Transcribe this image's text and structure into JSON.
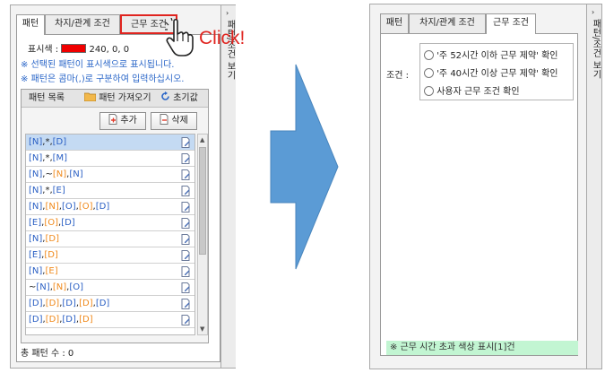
{
  "left_panel": {
    "tabs": [
      "패턴",
      "차지/관계 조건",
      "근무 조건"
    ],
    "color_label": "표시색 :",
    "color_value": "240, 0, 0",
    "notes": [
      "※ 선택된 패턴이 표시색으로 표시됩니다.",
      "※ 패턴은 콤마(,)로 구분하여 입력하십시오."
    ],
    "list_tab": "패턴 목록",
    "import_label": "패턴 가져오기",
    "reset_label": "초기값",
    "add_label": "추가",
    "delete_label": "삭제",
    "patterns": [
      [
        {
          "t": "[N]",
          "c": "b"
        },
        {
          "t": ",*,",
          "c": "k"
        },
        {
          "t": "[D]",
          "c": "b"
        }
      ],
      [
        {
          "t": "[N]",
          "c": "b"
        },
        {
          "t": ",*,",
          "c": "k"
        },
        {
          "t": "[M]",
          "c": "b"
        }
      ],
      [
        {
          "t": "[N]",
          "c": "b"
        },
        {
          "t": ",~",
          "c": "k"
        },
        {
          "t": "[N]",
          "c": "o"
        },
        {
          "t": ",",
          "c": "k"
        },
        {
          "t": "[N]",
          "c": "b"
        }
      ],
      [
        {
          "t": "[N]",
          "c": "b"
        },
        {
          "t": ",*,",
          "c": "k"
        },
        {
          "t": "[E]",
          "c": "b"
        }
      ],
      [
        {
          "t": "[N]",
          "c": "b"
        },
        {
          "t": ",",
          "c": "k"
        },
        {
          "t": "[N]",
          "c": "o"
        },
        {
          "t": ",",
          "c": "k"
        },
        {
          "t": "[O]",
          "c": "b"
        },
        {
          "t": ",",
          "c": "k"
        },
        {
          "t": "[O]",
          "c": "o"
        },
        {
          "t": ",",
          "c": "k"
        },
        {
          "t": "[D]",
          "c": "b"
        }
      ],
      [
        {
          "t": "[E]",
          "c": "b"
        },
        {
          "t": ",",
          "c": "k"
        },
        {
          "t": "[O]",
          "c": "o"
        },
        {
          "t": ",",
          "c": "k"
        },
        {
          "t": "[D]",
          "c": "b"
        }
      ],
      [
        {
          "t": "[N]",
          "c": "b"
        },
        {
          "t": ",",
          "c": "k"
        },
        {
          "t": "[D]",
          "c": "o"
        }
      ],
      [
        {
          "t": "[E]",
          "c": "b"
        },
        {
          "t": ",",
          "c": "k"
        },
        {
          "t": "[D]",
          "c": "o"
        }
      ],
      [
        {
          "t": "[N]",
          "c": "b"
        },
        {
          "t": ",",
          "c": "k"
        },
        {
          "t": "[E]",
          "c": "o"
        }
      ],
      [
        {
          "t": "~",
          "c": "k"
        },
        {
          "t": "[N]",
          "c": "b"
        },
        {
          "t": ",",
          "c": "k"
        },
        {
          "t": "[N]",
          "c": "o"
        },
        {
          "t": ",",
          "c": "k"
        },
        {
          "t": "[O]",
          "c": "b"
        }
      ],
      [
        {
          "t": "[D]",
          "c": "b"
        },
        {
          "t": ",",
          "c": "k"
        },
        {
          "t": "[D]",
          "c": "o"
        },
        {
          "t": ",",
          "c": "k"
        },
        {
          "t": "[D]",
          "c": "b"
        },
        {
          "t": ",",
          "c": "k"
        },
        {
          "t": "[D]",
          "c": "o"
        },
        {
          "t": ",",
          "c": "k"
        },
        {
          "t": "[D]",
          "c": "b"
        }
      ],
      [
        {
          "t": "[D]",
          "c": "b"
        },
        {
          "t": ",",
          "c": "k"
        },
        {
          "t": "[D]",
          "c": "o"
        },
        {
          "t": ",",
          "c": "k"
        },
        {
          "t": "[D]",
          "c": "b"
        },
        {
          "t": ",",
          "c": "k"
        },
        {
          "t": "[D]",
          "c": "o"
        }
      ]
    ],
    "total_label": "총 패턴 수 : 0",
    "side_label": "패턴/조건 보기",
    "click_text": "Click!"
  },
  "right_panel": {
    "tabs": [
      "패턴",
      "차지/관계 조건",
      "근무 조건"
    ],
    "condition_label": "조건 :",
    "options": [
      "'주 52시간 이하 근무 제약' 확인",
      "'주 40시간 이상 근무 제약' 확인",
      "사용자 근무 조건 확인"
    ],
    "selected_index": 0,
    "status": "※ 근무 시간 초과 색상 표시[1]건",
    "side_label": "패턴/조건 보기"
  },
  "colors": {
    "pattern_blue": "#2a5fc4",
    "pattern_orange": "#f08a1c",
    "swatch_red": "#f00000",
    "highlight_red": "#e0241f",
    "arrow_blue": "#5b9bd5",
    "status_green": "#c2f5d2"
  }
}
